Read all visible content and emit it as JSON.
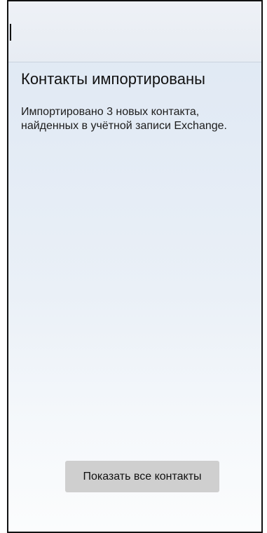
{
  "dialog": {
    "title": "Контакты импортированы",
    "message": "Импортировано 3 новых контакта, найденных в учётной записи Exchange.",
    "button_label": "Показать все контакты"
  }
}
